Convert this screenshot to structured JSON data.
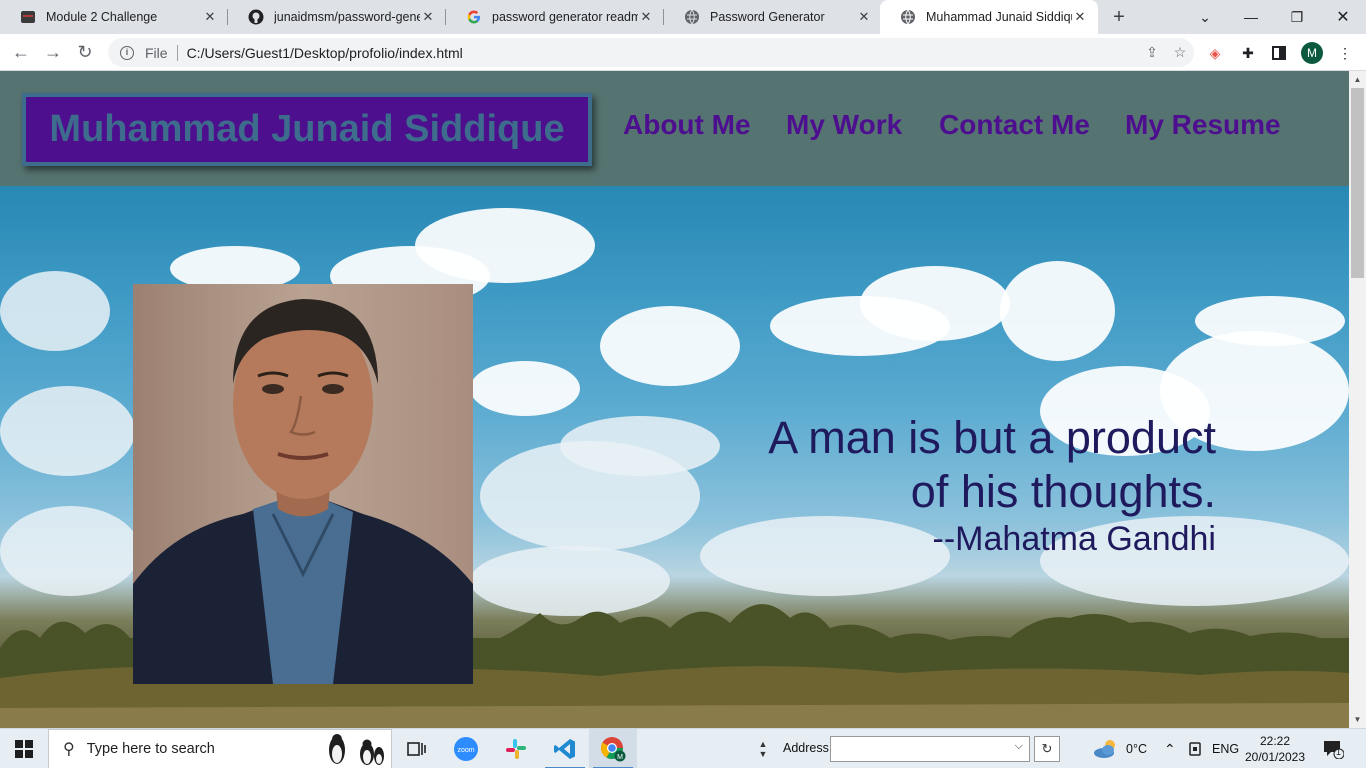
{
  "browser": {
    "tabs": [
      {
        "label": "Module 2 Challenge",
        "icon": "module-favicon",
        "active": false
      },
      {
        "label": "junaidmsm/password-generator",
        "icon": "github-icon",
        "active": false
      },
      {
        "label": "password generator readme",
        "icon": "google-icon",
        "active": false
      },
      {
        "label": "Password Generator",
        "icon": "globe-icon",
        "active": false
      },
      {
        "label": "Muhammad Junaid Siddique",
        "icon": "globe-icon",
        "active": true
      }
    ],
    "url_scheme_label": "File",
    "url": "C:/Users/Guest1/Desktop/profolio/index.html",
    "profile_initial": "M"
  },
  "site": {
    "title": "Muhammad Junaid Siddique",
    "nav": [
      "About Me",
      "My Work",
      "Contact Me",
      "My Resume"
    ],
    "quote_line1": "A man is but a product",
    "quote_line2": "of his thoughts.",
    "quote_author": "--Mahatma Gandhi",
    "colors": {
      "header_bg": "#557370",
      "title_bg": "#4e0f8f",
      "title_text": "#3d6c8c",
      "nav_text": "#4d0f8f",
      "quote_text": "#1f1a5e"
    }
  },
  "taskbar": {
    "search_placeholder": "Type here to search",
    "address_label": "Address",
    "weather_temp": "0°C",
    "language": "ENG",
    "time": "22:22",
    "date": "20/01/2023",
    "notification_count": "1"
  }
}
